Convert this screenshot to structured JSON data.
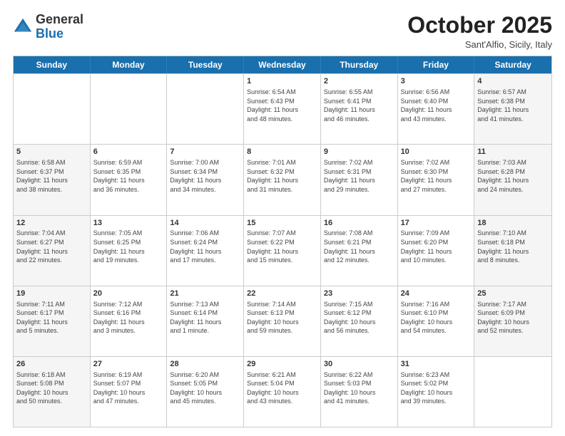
{
  "logo": {
    "general": "General",
    "blue": "Blue"
  },
  "header": {
    "month": "October 2025",
    "location": "Sant'Alfio, Sicily, Italy"
  },
  "days": [
    "Sunday",
    "Monday",
    "Tuesday",
    "Wednesday",
    "Thursday",
    "Friday",
    "Saturday"
  ],
  "weeks": [
    [
      {
        "day": "",
        "info": ""
      },
      {
        "day": "",
        "info": ""
      },
      {
        "day": "",
        "info": ""
      },
      {
        "day": "1",
        "info": "Sunrise: 6:54 AM\nSunset: 6:43 PM\nDaylight: 11 hours\nand 48 minutes."
      },
      {
        "day": "2",
        "info": "Sunrise: 6:55 AM\nSunset: 6:41 PM\nDaylight: 11 hours\nand 46 minutes."
      },
      {
        "day": "3",
        "info": "Sunrise: 6:56 AM\nSunset: 6:40 PM\nDaylight: 11 hours\nand 43 minutes."
      },
      {
        "day": "4",
        "info": "Sunrise: 6:57 AM\nSunset: 6:38 PM\nDaylight: 11 hours\nand 41 minutes."
      }
    ],
    [
      {
        "day": "5",
        "info": "Sunrise: 6:58 AM\nSunset: 6:37 PM\nDaylight: 11 hours\nand 38 minutes."
      },
      {
        "day": "6",
        "info": "Sunrise: 6:59 AM\nSunset: 6:35 PM\nDaylight: 11 hours\nand 36 minutes."
      },
      {
        "day": "7",
        "info": "Sunrise: 7:00 AM\nSunset: 6:34 PM\nDaylight: 11 hours\nand 34 minutes."
      },
      {
        "day": "8",
        "info": "Sunrise: 7:01 AM\nSunset: 6:32 PM\nDaylight: 11 hours\nand 31 minutes."
      },
      {
        "day": "9",
        "info": "Sunrise: 7:02 AM\nSunset: 6:31 PM\nDaylight: 11 hours\nand 29 minutes."
      },
      {
        "day": "10",
        "info": "Sunrise: 7:02 AM\nSunset: 6:30 PM\nDaylight: 11 hours\nand 27 minutes."
      },
      {
        "day": "11",
        "info": "Sunrise: 7:03 AM\nSunset: 6:28 PM\nDaylight: 11 hours\nand 24 minutes."
      }
    ],
    [
      {
        "day": "12",
        "info": "Sunrise: 7:04 AM\nSunset: 6:27 PM\nDaylight: 11 hours\nand 22 minutes."
      },
      {
        "day": "13",
        "info": "Sunrise: 7:05 AM\nSunset: 6:25 PM\nDaylight: 11 hours\nand 19 minutes."
      },
      {
        "day": "14",
        "info": "Sunrise: 7:06 AM\nSunset: 6:24 PM\nDaylight: 11 hours\nand 17 minutes."
      },
      {
        "day": "15",
        "info": "Sunrise: 7:07 AM\nSunset: 6:22 PM\nDaylight: 11 hours\nand 15 minutes."
      },
      {
        "day": "16",
        "info": "Sunrise: 7:08 AM\nSunset: 6:21 PM\nDaylight: 11 hours\nand 12 minutes."
      },
      {
        "day": "17",
        "info": "Sunrise: 7:09 AM\nSunset: 6:20 PM\nDaylight: 11 hours\nand 10 minutes."
      },
      {
        "day": "18",
        "info": "Sunrise: 7:10 AM\nSunset: 6:18 PM\nDaylight: 11 hours\nand 8 minutes."
      }
    ],
    [
      {
        "day": "19",
        "info": "Sunrise: 7:11 AM\nSunset: 6:17 PM\nDaylight: 11 hours\nand 5 minutes."
      },
      {
        "day": "20",
        "info": "Sunrise: 7:12 AM\nSunset: 6:16 PM\nDaylight: 11 hours\nand 3 minutes."
      },
      {
        "day": "21",
        "info": "Sunrise: 7:13 AM\nSunset: 6:14 PM\nDaylight: 11 hours\nand 1 minute."
      },
      {
        "day": "22",
        "info": "Sunrise: 7:14 AM\nSunset: 6:13 PM\nDaylight: 10 hours\nand 59 minutes."
      },
      {
        "day": "23",
        "info": "Sunrise: 7:15 AM\nSunset: 6:12 PM\nDaylight: 10 hours\nand 56 minutes."
      },
      {
        "day": "24",
        "info": "Sunrise: 7:16 AM\nSunset: 6:10 PM\nDaylight: 10 hours\nand 54 minutes."
      },
      {
        "day": "25",
        "info": "Sunrise: 7:17 AM\nSunset: 6:09 PM\nDaylight: 10 hours\nand 52 minutes."
      }
    ],
    [
      {
        "day": "26",
        "info": "Sunrise: 6:18 AM\nSunset: 5:08 PM\nDaylight: 10 hours\nand 50 minutes."
      },
      {
        "day": "27",
        "info": "Sunrise: 6:19 AM\nSunset: 5:07 PM\nDaylight: 10 hours\nand 47 minutes."
      },
      {
        "day": "28",
        "info": "Sunrise: 6:20 AM\nSunset: 5:05 PM\nDaylight: 10 hours\nand 45 minutes."
      },
      {
        "day": "29",
        "info": "Sunrise: 6:21 AM\nSunset: 5:04 PM\nDaylight: 10 hours\nand 43 minutes."
      },
      {
        "day": "30",
        "info": "Sunrise: 6:22 AM\nSunset: 5:03 PM\nDaylight: 10 hours\nand 41 minutes."
      },
      {
        "day": "31",
        "info": "Sunrise: 6:23 AM\nSunset: 5:02 PM\nDaylight: 10 hours\nand 39 minutes."
      },
      {
        "day": "",
        "info": ""
      }
    ]
  ]
}
